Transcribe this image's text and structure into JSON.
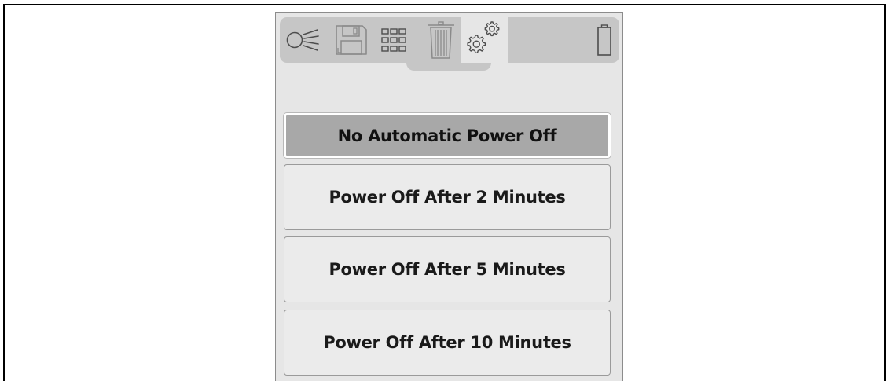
{
  "toolbar": {
    "tabs": [
      {
        "icon": "light-beam-icon",
        "active": false
      },
      {
        "icon": "save-icon",
        "active": false
      },
      {
        "icon": "grid-icon",
        "active": false
      },
      {
        "icon": "trash-icon",
        "active": false
      },
      {
        "icon": "gears-icon",
        "active": true
      }
    ],
    "status_icon": "battery-icon"
  },
  "menu": {
    "options": [
      {
        "label": "No Automatic Power Off",
        "selected": true
      },
      {
        "label": "Power Off After 2 Minutes",
        "selected": false
      },
      {
        "label": "Power Off After 5 Minutes",
        "selected": false
      },
      {
        "label": "Power Off After 10 Minutes",
        "selected": false
      }
    ]
  },
  "colors": {
    "screen_background": "#e6e6e6",
    "toolbar_background": "#c6c6c6",
    "selected_option": "#a8a8a8",
    "option_background": "#ebebeb",
    "icon_stroke": "#4d4d4d",
    "icon_stroke_faded": "#8a8a8a"
  }
}
